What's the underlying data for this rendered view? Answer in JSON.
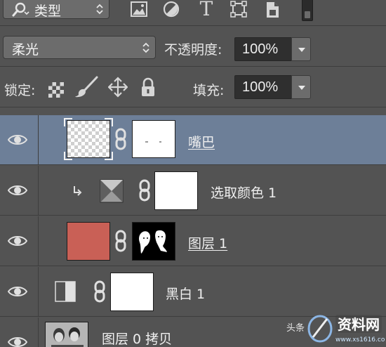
{
  "filter_bar": {
    "kind_label": "类型",
    "icons": [
      "pixel-layer-filter-icon",
      "adjustment-layer-filter-icon",
      "type-layer-filter-icon",
      "shape-layer-filter-icon",
      "smart-object-filter-icon"
    ],
    "type_glyph": "T"
  },
  "blend_bar": {
    "mode": "柔光",
    "opacity_label": "不透明度:",
    "opacity_value": "100%"
  },
  "lock_bar": {
    "lock_label": "锁定:",
    "fill_label": "填充:",
    "fill_value": "100%"
  },
  "layers": [
    {
      "name": "嘴巴",
      "selected": true,
      "thumb": "transparent",
      "mask": "white-with-small-marks"
    },
    {
      "name": "选取颜色 1",
      "selected": false,
      "thumb": "selective-color-adjustment",
      "mask": "white",
      "clipped": true
    },
    {
      "name": "图层 1",
      "selected": false,
      "thumb": "#c96056",
      "mask": "black-with-two-faces"
    },
    {
      "name": "黑白 1",
      "selected": false,
      "thumb": "black-white-adjustment",
      "mask": "white"
    },
    {
      "name": "图层 0 拷贝",
      "selected": false,
      "thumb": "photo"
    }
  ],
  "watermark": {
    "text": "头条"
  },
  "colors": {
    "panel_bg": "#535353",
    "selected_row": "#6d7f98",
    "layer1_fill": "#c96056"
  }
}
